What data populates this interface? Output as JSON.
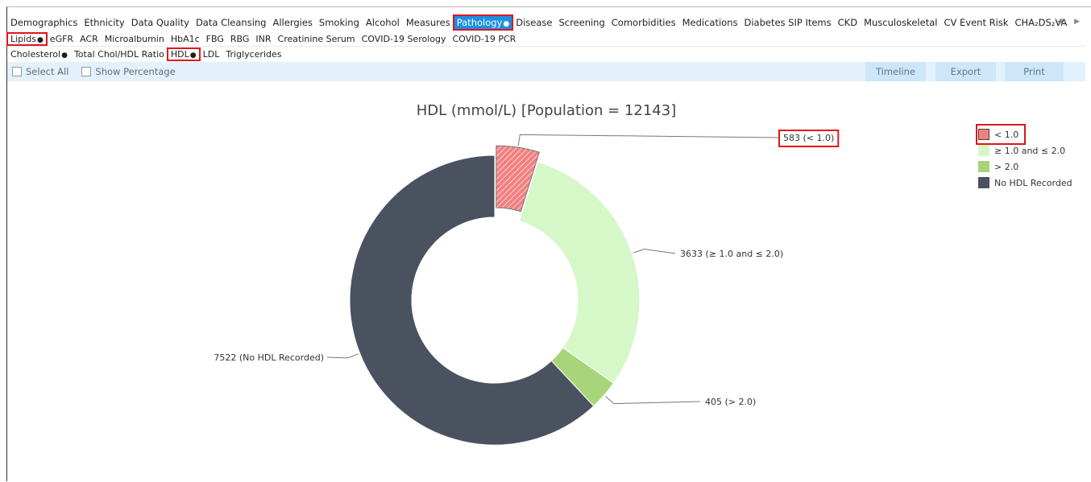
{
  "tabs_row1": [
    "Demographics",
    "Ethnicity",
    "Data Quality",
    "Data Cleansing",
    "Allergies",
    "Smoking",
    "Alcohol",
    "Measures",
    "Pathology",
    "Disease",
    "Screening",
    "Comorbidities",
    "Medications",
    "Diabetes SIP Items",
    "CKD",
    "Musculoskeletal",
    "CV Event Risk",
    "CHA₂DS₂VA"
  ],
  "tabs_row2": [
    "Lipids",
    "eGFR",
    "ACR",
    "Microalbumin",
    "HbA1c",
    "FBG",
    "RBG",
    "INR",
    "Creatinine Serum",
    "COVID-19 Serology",
    "COVID-19 PCR"
  ],
  "tabs_row3": [
    "Cholesterol",
    "Total Chol/HDL Ratio",
    "HDL",
    "LDL",
    "Triglycerides"
  ],
  "dot": "●",
  "scroll_arrows": "◀ ▶",
  "toolbar": {
    "select_all": "Select All",
    "show_percentage": "Show Percentage",
    "timeline": "Timeline",
    "export": "Export",
    "print": "Print"
  },
  "chart_data": {
    "type": "pie",
    "title": "HDL (mmol/L) [Population = 12143]",
    "slices": [
      {
        "label": "< 1.0",
        "value": 583,
        "data_label": "583 (< 1.0)",
        "color": "#f08080",
        "hatched": true,
        "exploded": true
      },
      {
        "label": "≥ 1.0 and ≤ 2.0",
        "value": 3633,
        "data_label": "3633 (≥ 1.0 and ≤ 2.0)",
        "color": "#d6f7c8"
      },
      {
        "label": "> 2.0",
        "value": 405,
        "data_label": "405 (> 2.0)",
        "color": "#a9d57a"
      },
      {
        "label": "No HDL Recorded",
        "value": 7522,
        "data_label": "7522 (No HDL Recorded)",
        "color": "#4a5260"
      }
    ],
    "legend_position": "top-right"
  }
}
